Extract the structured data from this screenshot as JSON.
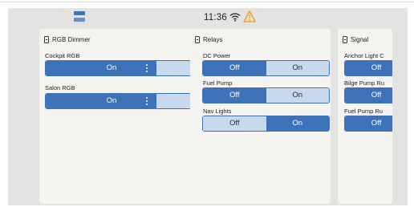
{
  "status": {
    "time": "11:36"
  },
  "icons": {
    "menu": "menu-icon",
    "wifi": "wifi-icon",
    "warning": "warning-icon",
    "panel": "battery-icon"
  },
  "colors": {
    "accent": "#3f73b9",
    "accent_light": "#c8d9ee",
    "warning": "#f0a030",
    "panel_bg": "#f6f4f1",
    "frame_bg": "#e5e3e1"
  },
  "dimmer_panel": {
    "title": "RGB Dimmer",
    "items": [
      {
        "label": "Cockpit RGB",
        "state": "On",
        "level": 0.75
      },
      {
        "label": "Salon RGB",
        "state": "On",
        "level": 0.75
      }
    ]
  },
  "relays_panel": {
    "title": "Relays",
    "items": [
      {
        "label": "DC Power",
        "off_label": "Off",
        "on_label": "On",
        "selected": "Off"
      },
      {
        "label": "Fuel Pump",
        "off_label": "Off",
        "on_label": "On",
        "selected": "Off"
      },
      {
        "label": "Nav Lights",
        "off_label": "Off",
        "on_label": "On",
        "selected": "On"
      }
    ]
  },
  "signal_panel": {
    "title": "Signal",
    "items": [
      {
        "label": "Anchor Light C",
        "off_label": "Off",
        "selected": "Off"
      },
      {
        "label": "Bilge Pump Ru",
        "off_label": "Off",
        "selected": "Off"
      },
      {
        "label": "Fuel Pump Ru",
        "off_label": "Off",
        "selected": "Off"
      }
    ]
  }
}
